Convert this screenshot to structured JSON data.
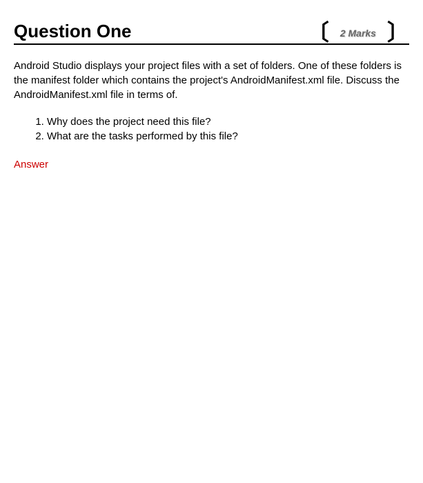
{
  "header": {
    "title": "Question One",
    "marks": "2 Marks",
    "bracket_left": "〔",
    "bracket_right": "〕"
  },
  "question": {
    "intro": "Android Studio displays your project files with a set of folders. One of these folders is the manifest folder which contains the project's AndroidManifest.xml file. Discuss the AndroidManifest.xml file in terms of.",
    "items": [
      "Why does the project need this file?",
      "What are the tasks performed by this file?"
    ]
  },
  "answer": {
    "label": "Answer"
  }
}
